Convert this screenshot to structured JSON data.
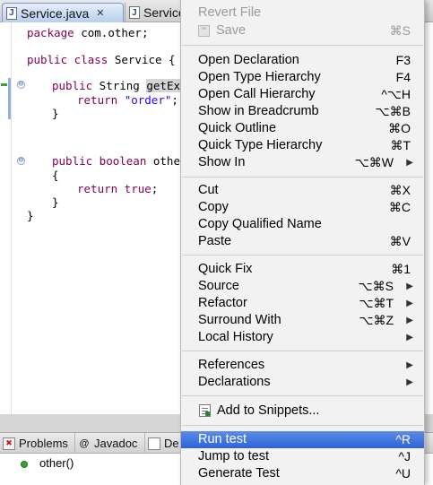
{
  "editor": {
    "tabs": [
      {
        "label": "Service.java",
        "close": "✕"
      },
      {
        "label": "Service"
      }
    ],
    "lines": {
      "l1": {
        "a": "package",
        "b": " com.other;"
      },
      "l2": {
        "a": "public class",
        "b": " Service {"
      },
      "l3": {
        "a": "public",
        "b": " String ",
        "c": "getExtr"
      },
      "l4": {
        "a": "return",
        "b": " ",
        "c": "\"order\"",
        "d": ";"
      },
      "l5": "}",
      "l6": {
        "a": "public boolean",
        "b": " othe"
      },
      "l7": "{",
      "l8": {
        "a": "return true",
        "b": ";"
      },
      "l9": "}",
      "l10": "}"
    },
    "fold_glyph": "⊖"
  },
  "views": {
    "tabs": [
      {
        "label": "Problems",
        "icon": "problems-icon"
      },
      {
        "label": "Javadoc",
        "icon": "at-icon",
        "glyph": "@"
      },
      {
        "label": "De",
        "icon": "declaration-icon"
      }
    ],
    "outline_item": "other()"
  },
  "menu": {
    "revert": {
      "label": "Revert File"
    },
    "save": {
      "label": "Save",
      "shortcut": "⌘S"
    },
    "open_declaration": {
      "label": "Open Declaration",
      "shortcut": "F3"
    },
    "open_type_hierarchy": {
      "label": "Open Type Hierarchy",
      "shortcut": "F4"
    },
    "open_call_hierarchy": {
      "label": "Open Call Hierarchy",
      "shortcut": "^⌥H"
    },
    "show_in_breadcrumb": {
      "label": "Show in Breadcrumb",
      "shortcut": "⌥⌘B"
    },
    "quick_outline": {
      "label": "Quick Outline",
      "shortcut": "⌘O"
    },
    "quick_type_hierarchy": {
      "label": "Quick Type Hierarchy",
      "shortcut": "⌘T"
    },
    "show_in": {
      "label": "Show In",
      "shortcut": "⌥⌘W"
    },
    "cut": {
      "label": "Cut",
      "shortcut": "⌘X"
    },
    "copy": {
      "label": "Copy",
      "shortcut": "⌘C"
    },
    "copy_qualified_name": {
      "label": "Copy Qualified Name"
    },
    "paste": {
      "label": "Paste",
      "shortcut": "⌘V"
    },
    "quick_fix": {
      "label": "Quick Fix",
      "shortcut": "⌘1"
    },
    "source": {
      "label": "Source",
      "shortcut": "⌥⌘S"
    },
    "refactor": {
      "label": "Refactor",
      "shortcut": "⌥⌘T"
    },
    "surround_with": {
      "label": "Surround With",
      "shortcut": "⌥⌘Z"
    },
    "local_history": {
      "label": "Local History"
    },
    "references": {
      "label": "References"
    },
    "declarations": {
      "label": "Declarations"
    },
    "add_to_snippets": {
      "label": "Add to Snippets..."
    },
    "run_test": {
      "label": "Run test",
      "shortcut": "^R"
    },
    "jump_to_test": {
      "label": "Jump to test",
      "shortcut": "^J"
    },
    "generate_test": {
      "label": "Generate Test",
      "shortcut": "^U"
    },
    "submenu_arrow": "▶"
  },
  "colors": {
    "keyword": "#7f0055",
    "string": "#2a00ff",
    "selection": "#2f62d8",
    "marker_green": "#3da13d"
  }
}
